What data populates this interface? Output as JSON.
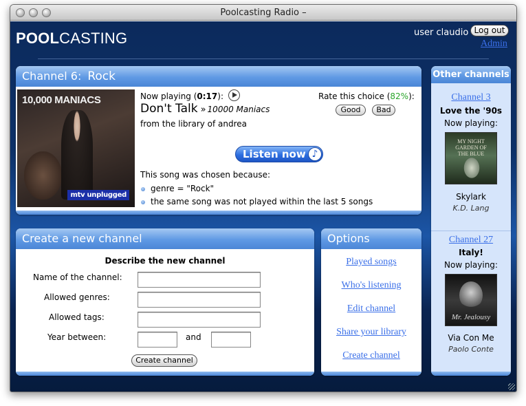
{
  "window": {
    "title": "Poolcasting Radio –"
  },
  "header": {
    "logo_bold": "POOL",
    "logo_light": "CASTING",
    "user_label": "user claudio",
    "logout_label": "Log out",
    "admin_label": "Admin"
  },
  "current_channel": {
    "number_label": "Channel 6:",
    "name": "Rock",
    "cover_band_text": "10,000 MANIACS",
    "cover_badge": "mtv unplugged",
    "now_playing_prefix": "Now playing (",
    "now_playing_time": "0:17",
    "now_playing_suffix": "):",
    "song_title": "Don't Talk",
    "song_separator": "»",
    "song_artist": "10000 Maniacs",
    "library_text": "from the library of andrea",
    "rate_prefix": "Rate this choice (",
    "rate_percent": "82%",
    "rate_suffix": "):",
    "good_label": "Good",
    "bad_label": "Bad",
    "listen_label": "Listen now",
    "reason_title": "This song was chosen because:",
    "reasons": [
      "genre = \"Rock\"",
      "the same song was not played within the last 5 songs"
    ]
  },
  "create_channel": {
    "title": "Create a new channel",
    "subtitle": "Describe the new channel",
    "name_label": "Name of the channel:",
    "genres_label": "Allowed genres:",
    "tags_label": "Allowed tags:",
    "year_label": "Year between:",
    "and_label": "and",
    "name_value": "",
    "genres_value": "",
    "tags_value": "",
    "year_from_value": "",
    "year_to_value": "",
    "button_label": "Create channel"
  },
  "options": {
    "title": "Options",
    "links": [
      "Played songs",
      "Who's listening",
      "Edit channel",
      "Share your library",
      "Create channel"
    ]
  },
  "other_channels": {
    "title": "Other channels",
    "channels": [
      {
        "link": "Channel 3",
        "name": "Love the '90s",
        "now_playing": "Now playing:",
        "cover_text": "MY NIGHT GARDEN OF THE BLUE",
        "song": "Skylark",
        "artist": "K.D. Lang"
      },
      {
        "link": "Channel 27",
        "name": "Italy!",
        "now_playing": "Now playing:",
        "cover_text": "Mr. Jealousy",
        "song": "Via Con Me",
        "artist": "Paolo Conte"
      }
    ]
  },
  "colors": {
    "link": "#3a6fe8",
    "rate_percent": "#2aa52a",
    "panel_header": "#5f99e4",
    "background": "#0d3168"
  }
}
